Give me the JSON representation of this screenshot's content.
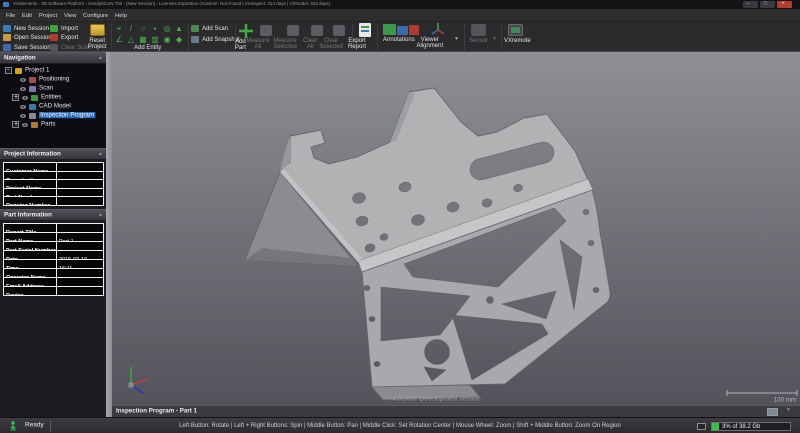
{
  "window": {
    "title": "VXelements - 3D Software Platform - HandySCAN 700 - [New Session] - Licenses Expiration (Scanner: Not Found | VXinspect: 314 days | VXmodel: 343 days)"
  },
  "menu": {
    "items": [
      "File",
      "Edit",
      "Project",
      "View",
      "Configure",
      "Help"
    ]
  },
  "toolbar": {
    "new_session": "New Session",
    "open_session": "Open Session",
    "save_session": "Save Session",
    "import": "Import",
    "export": "Export",
    "clear_scan": "Clear Scan",
    "reset_project": "Reset Project",
    "add_entity": {
      "label": "Add Entity",
      "icons": [
        {
          "name": "point-icon",
          "glyph": "⌖"
        },
        {
          "name": "line-icon",
          "glyph": "/"
        },
        {
          "name": "circle-icon",
          "glyph": "○"
        },
        {
          "name": "point-target-icon",
          "glyph": "▪"
        },
        {
          "name": "ellipse-icon",
          "glyph": "◎"
        },
        {
          "name": "cone-icon",
          "glyph": "▲"
        },
        {
          "name": "vector-icon",
          "glyph": "∠"
        },
        {
          "name": "triangle-icon",
          "glyph": "△"
        },
        {
          "name": "plane-icon",
          "glyph": "▦"
        },
        {
          "name": "slab-icon",
          "glyph": "▥"
        },
        {
          "name": "sphere-icon",
          "glyph": "◉"
        },
        {
          "name": "facet-icon",
          "glyph": "◆"
        }
      ]
    },
    "add_scan": "Add Scan",
    "add_snapshot": "Add Snapshot",
    "add_part": "Add Part",
    "measure_all": "Measure All",
    "measure_selected": "Measure Selected",
    "clear_all": "Clear All",
    "clear_selected": "Clear Selected",
    "export_report": "Export Report",
    "annotations": "Annotations",
    "viewer_alignment": "Viewer Alignment",
    "sensor": "Sensor",
    "vxremote": "VXremote"
  },
  "sidebar": {
    "navigation": {
      "title": "Navigation",
      "tree": [
        {
          "label": "Project 1",
          "expander": "-"
        },
        {
          "label": "Positioning"
        },
        {
          "label": "Scan"
        },
        {
          "label": "Entities",
          "expander": "+"
        },
        {
          "label": "CAD Model"
        },
        {
          "label": "Inspection Program",
          "selected": true
        },
        {
          "label": "Parts",
          "expander": "+"
        }
      ]
    },
    "project_info": {
      "title": "Project Information",
      "rows": [
        {
          "label": "Customer Name",
          "value": ""
        },
        {
          "label": "Organization",
          "value": ""
        },
        {
          "label": "Project Name",
          "value": ""
        },
        {
          "label": "Part Number",
          "value": ""
        },
        {
          "label": "Drawing Number",
          "value": ""
        }
      ]
    },
    "part_info": {
      "title": "Part Information",
      "rows": [
        {
          "label": "Report Title",
          "value": ""
        },
        {
          "label": "Part Name",
          "value": "Part 1"
        },
        {
          "label": "Part Serial Number",
          "value": ""
        },
        {
          "label": "Date",
          "value": "2015-03-16"
        },
        {
          "label": "Time",
          "value": "16:11"
        },
        {
          "label": "Operator Name",
          "value": ""
        },
        {
          "label": "Email Address",
          "value": ""
        },
        {
          "label": "Device",
          "value": ""
        }
      ]
    }
  },
  "viewport": {
    "version_text": "4.0.1657 Development version",
    "scale_label": "100 mm"
  },
  "tabbar": {
    "active_tab": "Inspection Program - Part 1"
  },
  "statusbar": {
    "ready": "Ready",
    "hints": "Left Button: Rotate  |  Left + Right Buttons: Spin  |  Middle Button: Pan  |  Middle Click: Set Rotation Center  |  Mouse Wheel: Zoom  |  Shift + Middle Button: Zoom On Region",
    "memory": "3% of 38.2 Gb"
  }
}
